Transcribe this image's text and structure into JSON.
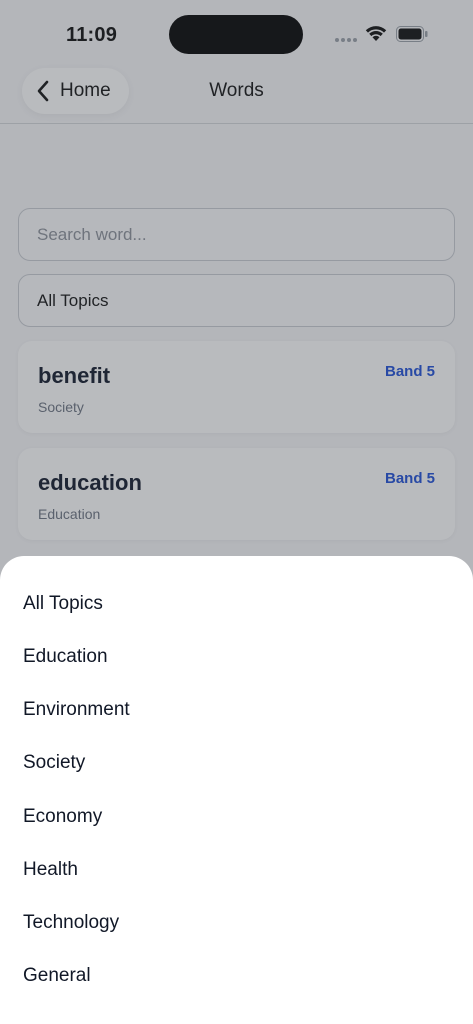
{
  "status_bar": {
    "time": "11:09",
    "icons": [
      "signal-dots-icon",
      "wifi-icon",
      "battery-icon"
    ]
  },
  "nav": {
    "back_label": "Home",
    "title": "Words"
  },
  "search": {
    "placeholder": "Search word...",
    "value": ""
  },
  "topic_filter": {
    "selected": "All Topics"
  },
  "words": [
    {
      "word": "benefit",
      "topic": "Society",
      "band": "Band 5"
    },
    {
      "word": "education",
      "topic": "Education",
      "band": "Band 5"
    }
  ],
  "topic_sheet": {
    "options": [
      "All Topics",
      "Education",
      "Environment",
      "Society",
      "Economy",
      "Health",
      "Technology",
      "General"
    ]
  },
  "colors": {
    "accent": "#1d4ed8",
    "overlay": "#3c424c",
    "text": "#111827"
  }
}
